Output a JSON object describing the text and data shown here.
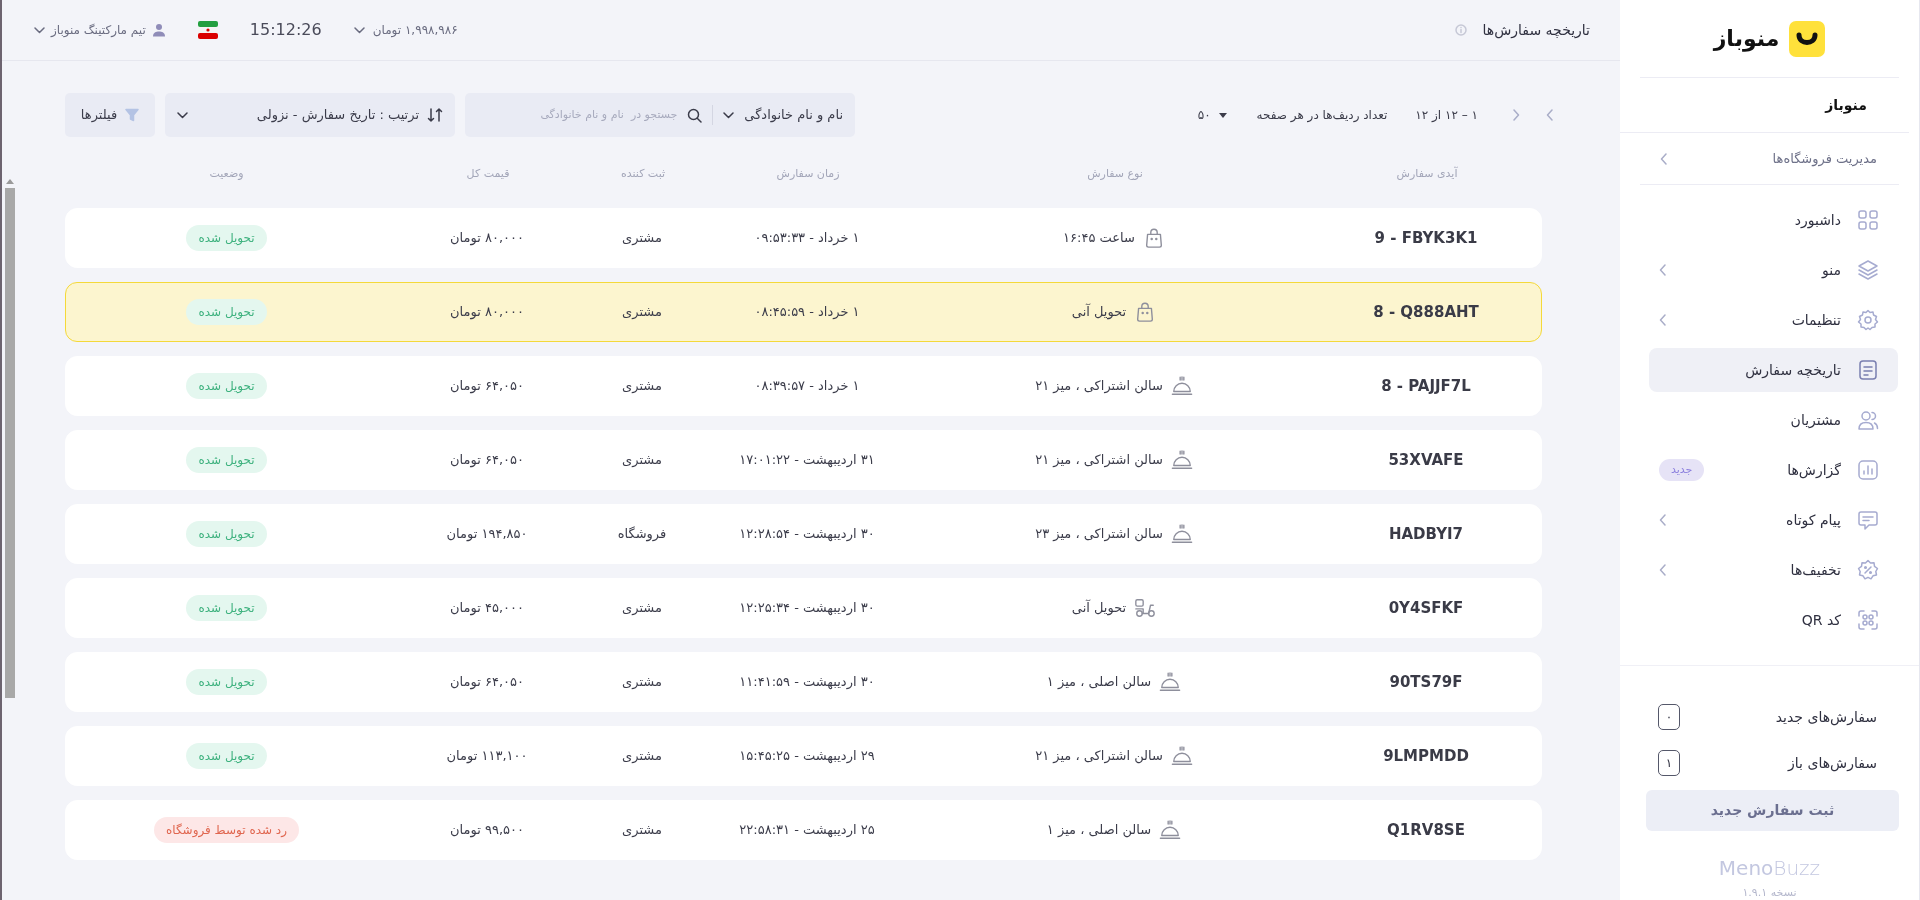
{
  "header": {
    "title": "تاریخچه سفارش‌ها",
    "balance": "۱,۹۹۸,۹۸۶ تومان",
    "time": "15:12:26",
    "user": "تیم مارکتینگ منوباز"
  },
  "toolbar": {
    "search_scope": "نام و نام خانوادگی",
    "search_placeholder": "جستجو در  نام و نام خانوادگی",
    "sort": "ترتیب : تاریخ سفارش - نزولی",
    "filters": "فیلترها",
    "rows_per_page_label": "تعداد ردیف‌ها در هر صفحه",
    "rows_per_page": "۵۰",
    "range": "۱ – ۱۲ از ۱۲"
  },
  "table": {
    "columns": [
      "آیدی سفارش",
      "نوع سفارش",
      "زمان سفارش",
      "ثبت کننده",
      "قیمت کل",
      "وضعیت"
    ],
    "rows": [
      {
        "id": "9 - FBYK3K1",
        "type": {
          "kind": "takeaway",
          "text": "ساعت ۱۶:۴۵"
        },
        "time": "۱ خرداد - ۰۹:۵۳:۳۳",
        "registrar": "مشتری",
        "price": "۸۰,۰۰۰ تومان",
        "status": {
          "kind": "delivered",
          "text": "تحویل شده"
        },
        "selected": false
      },
      {
        "id": "8 - Q888AHT",
        "type": {
          "kind": "takeaway",
          "text": "تحویل آنی"
        },
        "time": "۱ خرداد - ۰۸:۴۵:۵۹",
        "registrar": "مشتری",
        "price": "۸۰,۰۰۰ تومان",
        "status": {
          "kind": "delivered",
          "text": "تحویل شده"
        },
        "selected": true
      },
      {
        "id": "8 - PAJJF7L",
        "type": {
          "kind": "dinein",
          "text": "سالن اشتراکی ، میز ۲۱"
        },
        "time": "۱ خرداد - ۰۸:۳۹:۵۷",
        "registrar": "مشتری",
        "price": "۶۴,۰۵۰ تومان",
        "status": {
          "kind": "delivered",
          "text": "تحویل شده"
        },
        "selected": false
      },
      {
        "id": "53XVAFE",
        "type": {
          "kind": "dinein",
          "text": "سالن اشتراکی ، میز ۲۱"
        },
        "time": "۳۱ اردیبهشت - ۱۷:۰۱:۲۲",
        "registrar": "مشتری",
        "price": "۶۴,۰۵۰ تومان",
        "status": {
          "kind": "delivered",
          "text": "تحویل شده"
        },
        "selected": false
      },
      {
        "id": "HADBYI7",
        "type": {
          "kind": "dinein",
          "text": "سالن اشتراکی ، میز ۲۳"
        },
        "time": "۳۰ اردیبهشت - ۱۲:۲۸:۵۴",
        "registrar": "فروشگاه",
        "price": "۱۹۴,۸۵۰ تومان",
        "status": {
          "kind": "delivered",
          "text": "تحویل شده"
        },
        "selected": false
      },
      {
        "id": "0Y4SFKF",
        "type": {
          "kind": "delivery",
          "text": "تحویل آنی"
        },
        "time": "۳۰ اردیبهشت - ۱۲:۲۵:۳۴",
        "registrar": "مشتری",
        "price": "۴۵,۰۰۰ تومان",
        "status": {
          "kind": "delivered",
          "text": "تحویل شده"
        },
        "selected": false
      },
      {
        "id": "90TS79F",
        "type": {
          "kind": "dinein",
          "text": "سالن اصلی ، میز ۱"
        },
        "time": "۳۰ اردیبهشت - ۱۱:۴۱:۵۹",
        "registrar": "مشتری",
        "price": "۶۴,۰۵۰ تومان",
        "status": {
          "kind": "delivered",
          "text": "تحویل شده"
        },
        "selected": false
      },
      {
        "id": "9LMPMDD",
        "type": {
          "kind": "dinein",
          "text": "سالن اشتراکی ، میز ۲۱"
        },
        "time": "۲۹ اردیبهشت - ۱۵:۴۵:۲۵",
        "registrar": "مشتری",
        "price": "۱۱۳,۱۰۰ تومان",
        "status": {
          "kind": "delivered",
          "text": "تحویل شده"
        },
        "selected": false
      },
      {
        "id": "Q1RV8SE",
        "type": {
          "kind": "dinein",
          "text": "سالن اصلی ، میز ۱"
        },
        "time": "۲۵ اردیبهشت - ۲۲:۵۸:۳۱",
        "registrar": "مشتری",
        "price": "۹۹,۵۰۰ تومان",
        "status": {
          "kind": "rejected",
          "text": "رد شده توسط فروشگاه"
        },
        "selected": false
      }
    ]
  },
  "sidebar": {
    "logo_text": "منوباز",
    "account": "منوباز",
    "store_management": {
      "label": "مدیریت فروشگاه‌ها",
      "submenu": true
    },
    "items": [
      {
        "label": "داشبورد",
        "selected": false,
        "submenu": false
      },
      {
        "label": "منو",
        "selected": false,
        "submenu": true
      },
      {
        "label": "تنظیمات",
        "selected": false,
        "submenu": true
      },
      {
        "label": "تاریخچه سفارش",
        "selected": true,
        "submenu": false
      },
      {
        "label": "مشتریان",
        "selected": false,
        "submenu": false
      },
      {
        "label": "گزارش‌ها",
        "selected": false,
        "submenu": false,
        "badge": "جدید"
      },
      {
        "label": "پیام کوتاه",
        "selected": false,
        "submenu": true
      },
      {
        "label": "تخفیف‌ها",
        "selected": false,
        "submenu": true
      },
      {
        "label": "کد QR",
        "selected": false,
        "submenu": false
      }
    ],
    "counters": [
      {
        "label": "سفارش‌های جدید",
        "count": "۰"
      },
      {
        "label": "سفارش‌های باز",
        "count": "۱"
      }
    ],
    "new_order_button": "ثبت سفارش جدید",
    "brand": "**Meno**Buzz",
    "version": "نسخه ۱.۹.۱"
  }
}
